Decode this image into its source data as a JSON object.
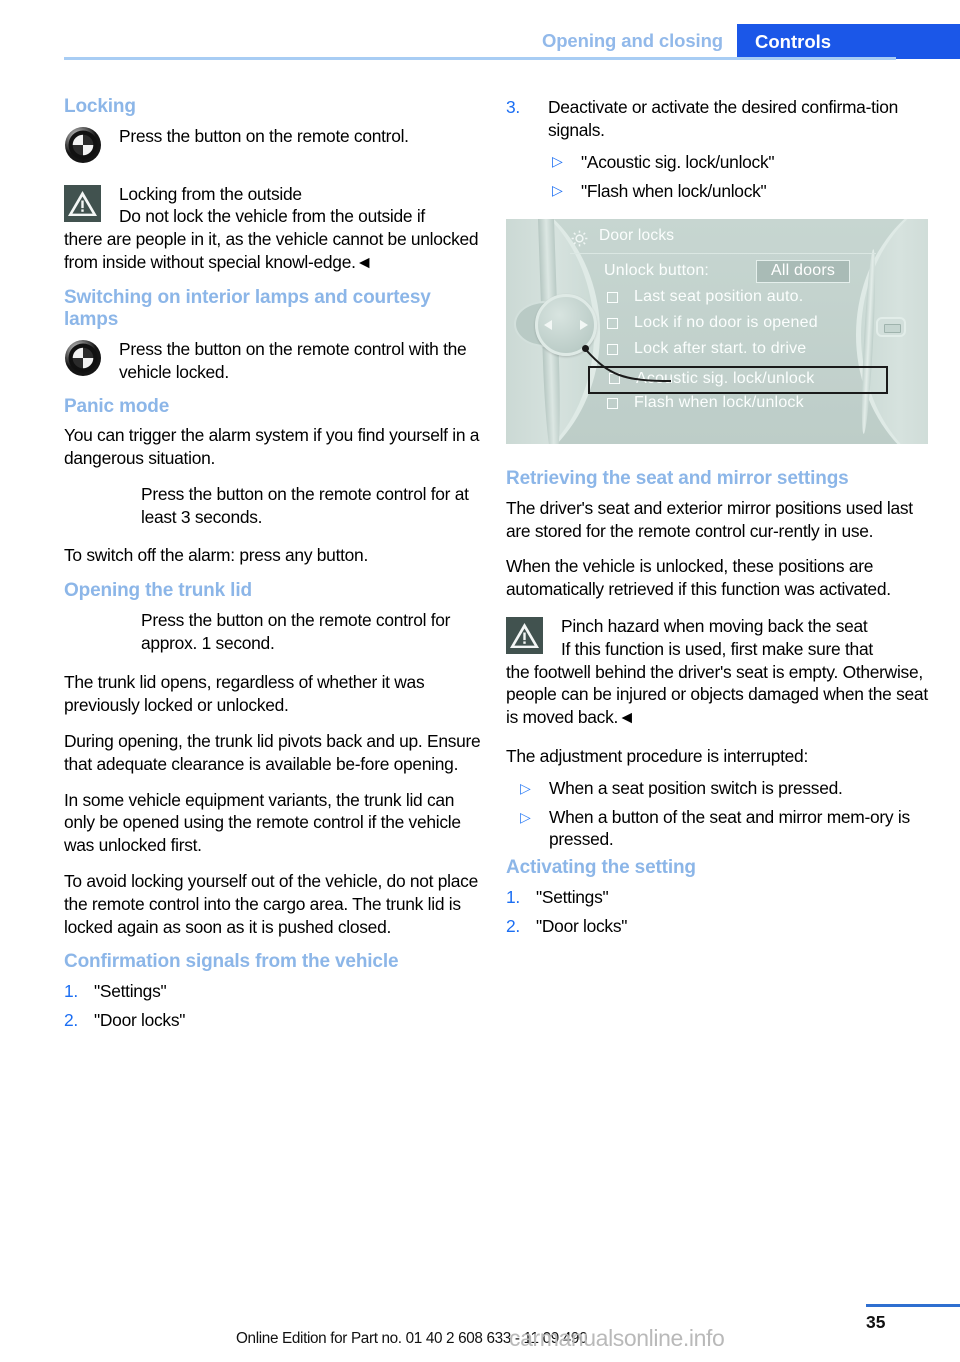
{
  "header": {
    "chapter": "Opening and closing",
    "section_tab": "Controls"
  },
  "left_column": {
    "locking": {
      "title": "Locking",
      "remote_instruction": "Press the button on the remote control.",
      "warning_title": "Locking from the outside",
      "warning_body": "Do not lock the vehicle from the outside if",
      "warning_rest": "there are people in it, as the vehicle cannot be unlocked from inside without special knowl-edge.◄"
    },
    "interior_lamps": {
      "title": "Switching on interior lamps and courtesy lamps",
      "instruction": "Press the button on the remote control with the vehicle locked."
    },
    "panic_mode": {
      "title": "Panic mode",
      "intro": "You can trigger the alarm system if you find yourself in a dangerous situation.",
      "instruction": "Press the button on the remote control for at least 3 seconds.",
      "switch_off": "To switch off the alarm: press any button."
    },
    "trunk_lid": {
      "title": "Opening the trunk lid",
      "instruction": "Press the button on the remote control for approx. 1 second.",
      "p1": "The trunk lid opens, regardless of whether it was previously locked or unlocked.",
      "p2": "During opening, the trunk lid pivots back and up. Ensure that adequate clearance is available be-fore opening.",
      "p3": "In some vehicle equipment variants, the trunk lid can only be opened using the remote control if the vehicle was unlocked first.",
      "p4": "To avoid locking yourself out of the vehicle, do not place the remote control into the cargo area. The trunk lid is locked again as soon as it is pushed closed."
    },
    "confirmation_signals": {
      "title": "Confirmation signals from the vehicle",
      "steps": [
        {
          "number": "1.",
          "text": "\"Settings\""
        },
        {
          "number": "2.",
          "text": "\"Door locks\""
        }
      ]
    }
  },
  "right_column": {
    "step3": {
      "number": "3.",
      "text": "Deactivate or activate the desired confirma-tion signals.",
      "bullets": [
        {
          "marker": "▷",
          "text": "\"Acoustic sig. lock/unlock\""
        },
        {
          "marker": "▷",
          "text": "\"Flash when lock/unlock\""
        }
      ]
    },
    "idrive_figure": {
      "screen_title": "Door locks",
      "unlock_label": "Unlock button:",
      "unlock_value": "All doors",
      "options": [
        {
          "label": "Last seat position auto.",
          "checked": false,
          "selected": false
        },
        {
          "label": "Lock if no door is opened",
          "checked": false,
          "selected": false
        },
        {
          "label": "Lock after start. to drive",
          "checked": false,
          "selected": false
        },
        {
          "label": "Acoustic sig. lock/unlock",
          "checked": false,
          "selected": true
        },
        {
          "label": "Flash when lock/unlock",
          "checked": false,
          "selected": false
        }
      ]
    },
    "seat_mirror": {
      "title": "Retrieving the seat and mirror settings",
      "p1": "The driver's seat and exterior mirror positions used last are stored for the remote control cur-rently in use.",
      "p2": "When the vehicle is unlocked, these positions are automatically retrieved if this function was activated.",
      "warning_title": "Pinch hazard when moving back the seat",
      "warning_body": "If this function is used, first make sure that",
      "warning_rest": "the footwell behind the driver's seat is empty. Otherwise, people can be injured or objects damaged when the seat is moved back.◄",
      "interrupt_intro": "The adjustment procedure is interrupted:",
      "interrupt_bullets": [
        {
          "marker": "▷",
          "text": "When a seat position switch is pressed."
        },
        {
          "marker": "▷",
          "text": "When a button of the seat and mirror mem-ory is pressed."
        }
      ]
    },
    "activating_setting": {
      "title": "Activating the setting",
      "steps": [
        {
          "number": "1.",
          "text": "\"Settings\""
        },
        {
          "number": "2.",
          "text": "\"Door locks\""
        }
      ]
    }
  },
  "footer": {
    "edition_text": "Online Edition for Part no. 01 40 2 608 633 - 11 09 490",
    "page_number": "35",
    "watermark": "carmanualsonline.info"
  },
  "colors": {
    "heading_blue": "#8cb6e8",
    "tab_blue": "#1b57e8",
    "rule_blue": "#a8cdf4",
    "list_number_blue": "#1b6ef3",
    "footer_rule_blue": "#2f6fd0"
  }
}
